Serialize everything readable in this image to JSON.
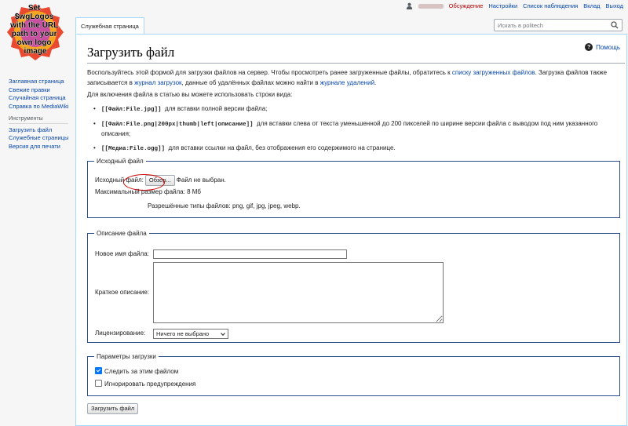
{
  "logo": {
    "text": [
      "Set",
      "$wgLogos",
      "with the URL",
      "path to your",
      "own logo",
      "image"
    ]
  },
  "personal": {
    "talk": "Обсуждение",
    "preferences": "Настройки",
    "watchlist": "Список наблюдения",
    "logout": "Выход",
    "contributions": "Вклад"
  },
  "tabs": {
    "special_page": "Служебная страница"
  },
  "search": {
    "placeholder": "Искать в politech"
  },
  "sidebar": {
    "nav": [
      "Заглавная страница",
      "Свежие правки",
      "Случайная страница",
      "Справка по MediaWiki"
    ],
    "tools_heading": "Инструменты",
    "tools": [
      "Загрузить файл",
      "Служебные страницы",
      "Версия для печати"
    ]
  },
  "page": {
    "title": "Загрузить файл",
    "help": "Помощь",
    "intro": {
      "t1": "Воспользуйтесь этой формой для загрузки файлов на сервер. Чтобы просмотреть ранее загруженные файлы, обратитесь к ",
      "link1": "списку загруженных файлов",
      "t2": ". Загрузка файлов также записывается в ",
      "link2": "журнал загрузок",
      "t3": ", данные об удалённых файлах можно найти в ",
      "link3": "журнале удалений",
      "t4": "."
    },
    "embed_intro": "Для включения файла в статью вы можете использовать строки вида:",
    "usage": [
      {
        "code": "[[Файл:File.jpg]]",
        "desc": "для вставки полной версии файла;"
      },
      {
        "code": "[[Файл:File.png|200px|thumb|left|описание]]",
        "desc": "для вставки слева от текста уменьшенной до 200 пикселей по ширине версии файла с выводом под ним указанного описания;"
      },
      {
        "code": "[[Медиа:File.ogg]]",
        "desc": "для вставки ссылки на файл, без отображения его содержимого на странице."
      }
    ]
  },
  "source": {
    "legend": "Исходный файл",
    "label": "Исходный файл:",
    "browse": "Обзор...",
    "no_file": "Файл не выбран.",
    "max_size": "Максимальный размер файла: 8 Мб",
    "types": "Разрешённые типы файлов: png, gif, jpg, jpeg, webp."
  },
  "description": {
    "legend": "Описание файла",
    "new_name_label": "Новое имя файла:",
    "new_name_value": "",
    "summary_label": "Краткое описание:",
    "summary_value": "",
    "license_label": "Лицензирование:",
    "license_value": "Ничего не выбрано"
  },
  "options": {
    "legend": "Параметры загрузки",
    "watch": "Следить за этим файлом",
    "watch_checked": true,
    "ignore": "Игнорировать предупреждения",
    "ignore_checked": false
  },
  "submit": "Загрузить файл",
  "colors": {
    "link": "#0645ad",
    "redlink": "#ba0000",
    "border": "#a7d7f9",
    "fieldset": "#2a4b8d",
    "highlight": "#cc0000"
  }
}
